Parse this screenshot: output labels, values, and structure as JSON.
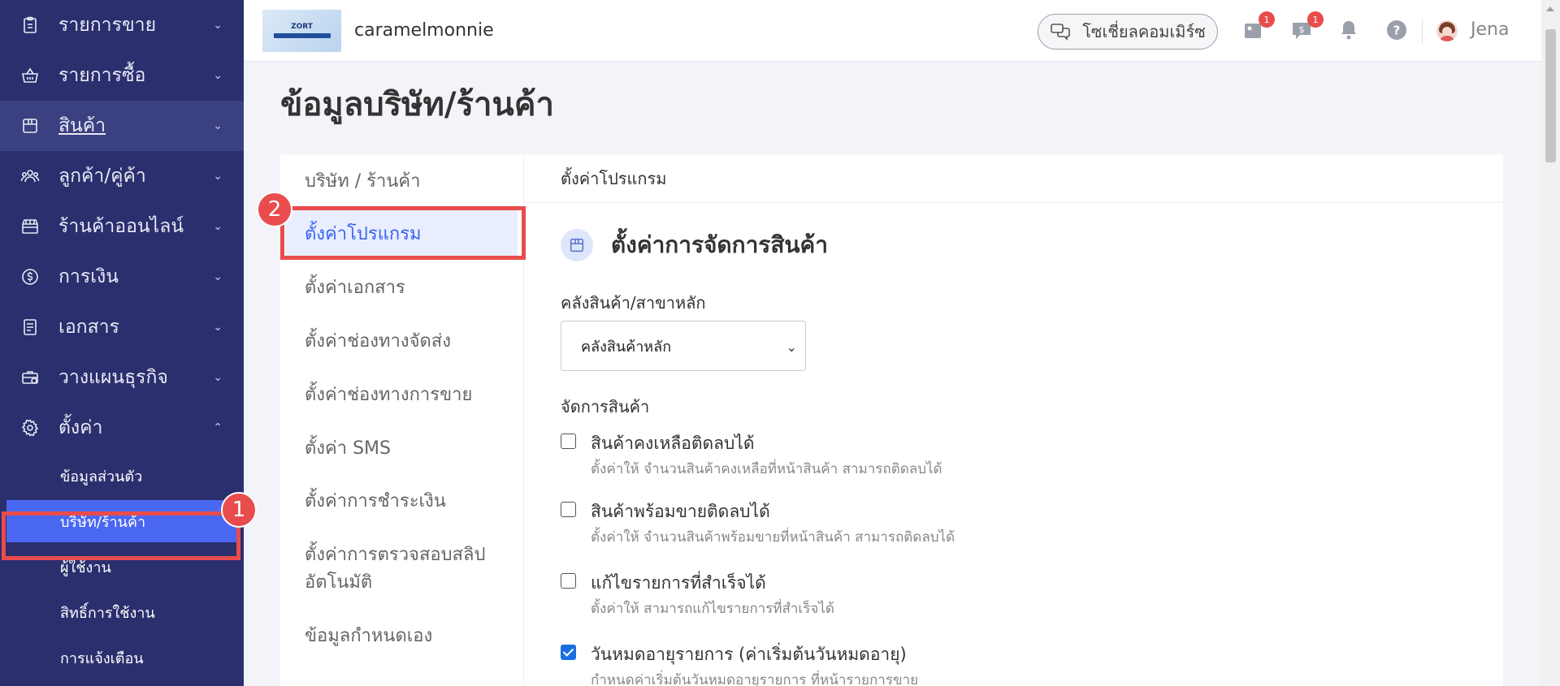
{
  "sidebar": {
    "items": [
      {
        "label": "รายการขาย",
        "icon": "clipboard-icon"
      },
      {
        "label": "รายการซื้อ",
        "icon": "basket-icon"
      },
      {
        "label": "สินค้า",
        "icon": "box-icon"
      },
      {
        "label": "ลูกค้า/คู่ค้า",
        "icon": "users-icon"
      },
      {
        "label": "ร้านค้าออนไลน์",
        "icon": "storefront-icon"
      },
      {
        "label": "การเงิน",
        "icon": "dollar-icon"
      },
      {
        "label": "เอกสาร",
        "icon": "document-icon"
      },
      {
        "label": "วางแผนธุรกิจ",
        "icon": "briefcase-icon"
      },
      {
        "label": "ตั้งค่า",
        "icon": "gear-icon"
      }
    ],
    "sub_items": [
      "ข้อมูลส่วนตัว",
      "บริษัท/ร้านค้า",
      "ผู้ใช้งาน",
      "สิทธิ์การใช้งาน",
      "การแจ้งเตือน"
    ]
  },
  "callouts": {
    "one": "1",
    "two": "2"
  },
  "topbar": {
    "logo_text": "ZORT",
    "shop_name": "caramelmonnie",
    "social_label": "โซเชี่ยลคอมเมิร์ซ",
    "notification_count_1": "1",
    "notification_count_2": "1",
    "user_name": "Jena"
  },
  "page": {
    "title": "ข้อมูลบริษัท/ร้านค้า"
  },
  "settings_menu": {
    "items": [
      "บริษัท / ร้านค้า",
      "ตั้งค่าโปรแกรม",
      "ตั้งค่าเอกสาร",
      "ตั้งค่าช่องทางจัดส่ง",
      "ตั้งค่าช่องทางการขาย",
      "ตั้งค่า SMS",
      "ตั้งค่าการชำระเงิน",
      "ตั้งค่าการตรวจสอบสลิป",
      "อัตโนมัติ",
      "ข้อมูลกำหนดเอง"
    ]
  },
  "content": {
    "header": "ตั้งค่าโปรแกรม",
    "section_title": "ตั้งค่าการจัดการสินค้า",
    "warehouse_label": "คลังสินค้า/สาขาหลัก",
    "warehouse_value": "คลังสินค้าหลัก",
    "manage_label": "จัดการสินค้า",
    "options": [
      {
        "title": "สินค้าคงเหลือติดลบได้",
        "desc": "ตั้งค่าให้ จำนวนสินค้าคงเหลือที่หน้าสินค้า สามารถติดลบได้",
        "checked": false
      },
      {
        "title": "สินค้าพร้อมขายติดลบได้",
        "desc": "ตั้งค่าให้ จำนวนสินค้าพร้อมขายที่หน้าสินค้า สามารถติดลบได้",
        "checked": false
      },
      {
        "title": "แก้ไขรายการที่สำเร็จได้",
        "desc": "ตั้งค่าให้ สามารถแก้ไขรายการที่สำเร็จได้",
        "checked": false
      },
      {
        "title": "วันหมดอายุรายการ (ค่าเริ่มต้นวันหมดอายุ)",
        "desc": "กำหนดค่าเริ่มต้นวันหมดอายุรายการ ที่หน้ารายการขาย",
        "checked": true
      }
    ]
  },
  "colors": {
    "sidebar_bg": "#2b2f6e",
    "accent": "#4a67f2",
    "highlight_box": "#e84c4c",
    "link_active": "#3b64f0"
  }
}
